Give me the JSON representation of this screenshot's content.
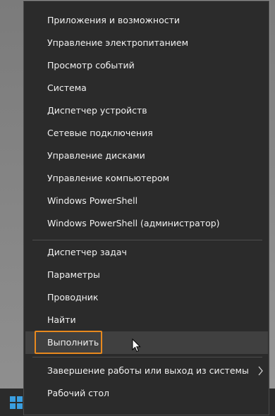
{
  "menu": {
    "items": [
      {
        "label": "Приложения и возможности"
      },
      {
        "label": "Управление электропитанием"
      },
      {
        "label": "Просмотр событий"
      },
      {
        "label": "Система"
      },
      {
        "label": "Диспетчер устройств"
      },
      {
        "label": "Сетевые подключения"
      },
      {
        "label": "Управление дисками"
      },
      {
        "label": "Управление компьютером"
      },
      {
        "label": "Windows PowerShell"
      },
      {
        "label": "Windows PowerShell (администратор)"
      },
      {
        "label": "Диспетчер задач"
      },
      {
        "label": "Параметры"
      },
      {
        "label": "Проводник"
      },
      {
        "label": "Найти"
      },
      {
        "label": "Выполнить"
      },
      {
        "label": "Завершение работы или выход из системы"
      },
      {
        "label": "Рабочий стол"
      }
    ],
    "hovered_item": "Выполнить",
    "submenu_icon": "chevron-right-icon",
    "highlight_color": "#e8891e"
  },
  "taskbar": {
    "start_icon": "windows-logo-icon",
    "accent": "#3a9ee0"
  }
}
